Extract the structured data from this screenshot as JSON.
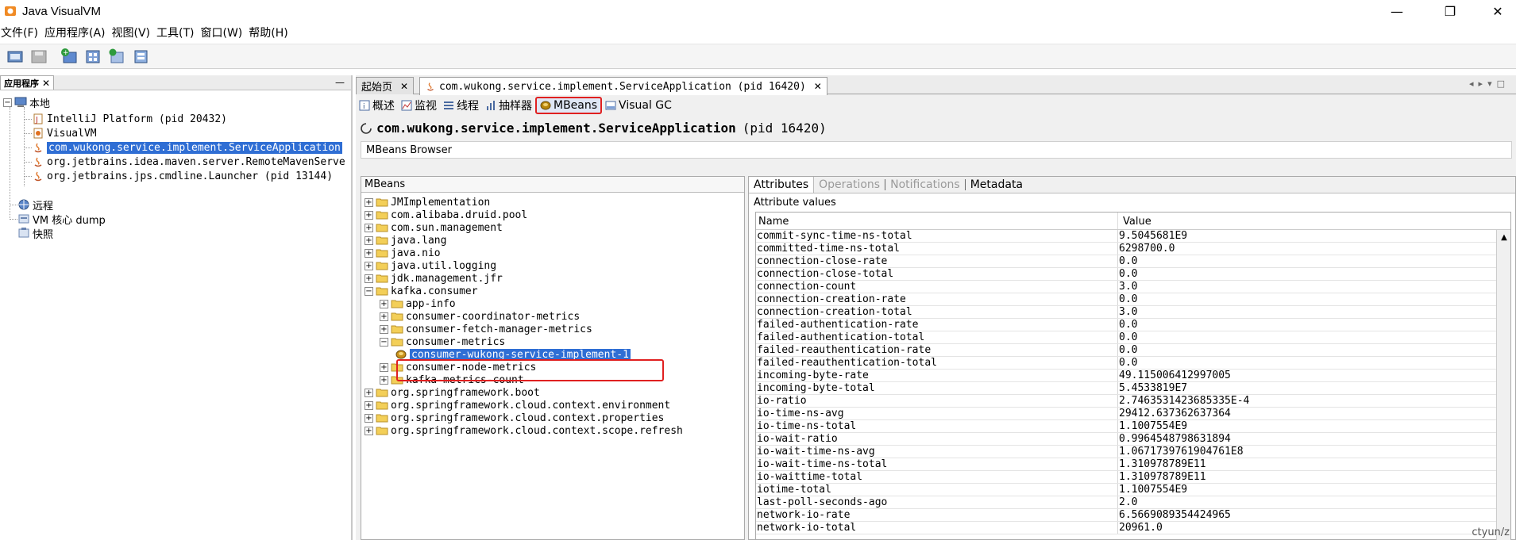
{
  "window": {
    "title": "Java VisualVM",
    "minimize": "—",
    "maximize": "❐",
    "close": "✕"
  },
  "menu": [
    "文件(F)",
    "应用程序(A)",
    "视图(V)",
    "工具(T)",
    "窗口(W)",
    "帮助(H)"
  ],
  "left_panel": {
    "tab_label": "应用程序",
    "tab_close": "✕",
    "minimize": "—",
    "local": "本地",
    "apps": [
      "IntelliJ Platform (pid 20432)",
      "VisualVM",
      "com.wukong.service.implement.ServiceApplication",
      "org.jetbrains.idea.maven.server.RemoteMavenServe",
      "org.jetbrains.jps.cmdline.Launcher (pid 13144)"
    ],
    "remote": "远程",
    "vm_dump": "VM 核心 dump",
    "snapshot": "快照"
  },
  "doc_tabs": {
    "start_page": "起始页",
    "app_tab": "com.wukong.service.implement.ServiceApplication (pid 16420)",
    "close": "✕"
  },
  "sub_tabs": [
    "概述",
    "监视",
    "线程",
    "抽样器",
    "MBeans",
    "Visual GC"
  ],
  "app_header": {
    "name": "com.wukong.service.implement.ServiceApplication",
    "pid": "(pid 16420)"
  },
  "mbeans_browser_label": "MBeans Browser",
  "mbeans_pane_title": "MBeans",
  "mbeans_tree": {
    "top_before": [
      "JMImplementation",
      "com.alibaba.druid.pool",
      "com.sun.management",
      "java.lang",
      "java.nio",
      "java.util.logging",
      "jdk.management.jfr"
    ],
    "kafka": "kafka.consumer",
    "kafka_children_before": [
      "app-info",
      "consumer-coordinator-metrics",
      "consumer-fetch-manager-metrics"
    ],
    "consumer_metrics": "consumer-metrics",
    "selected_leaf": "consumer-wukong-service-implement-1",
    "kafka_children_after": [
      "consumer-node-metrics",
      "kafka-metrics-count"
    ],
    "top_after": [
      "org.springframework.boot",
      "org.springframework.cloud.context.environment",
      "org.springframework.cloud.context.properties",
      "org.springframework.cloud.context.scope.refresh"
    ]
  },
  "detail_tabs": [
    "Attributes",
    "Operations",
    "Notifications",
    "Metadata"
  ],
  "attr_values_label": "Attribute values",
  "attr_table": {
    "col_name": "Name",
    "col_value": "Value",
    "rows": [
      [
        "commit-sync-time-ns-total",
        "9.5045681E9"
      ],
      [
        "committed-time-ns-total",
        "6298700.0"
      ],
      [
        "connection-close-rate",
        "0.0"
      ],
      [
        "connection-close-total",
        "0.0"
      ],
      [
        "connection-count",
        "3.0"
      ],
      [
        "connection-creation-rate",
        "0.0"
      ],
      [
        "connection-creation-total",
        "3.0"
      ],
      [
        "failed-authentication-rate",
        "0.0"
      ],
      [
        "failed-authentication-total",
        "0.0"
      ],
      [
        "failed-reauthentication-rate",
        "0.0"
      ],
      [
        "failed-reauthentication-total",
        "0.0"
      ],
      [
        "incoming-byte-rate",
        "49.115006412997005"
      ],
      [
        "incoming-byte-total",
        "5.4533819E7"
      ],
      [
        "io-ratio",
        "2.7463531423685335E-4"
      ],
      [
        "io-time-ns-avg",
        "29412.637362637364"
      ],
      [
        "io-time-ns-total",
        "1.1007554E9"
      ],
      [
        "io-wait-ratio",
        "0.9964548798631894"
      ],
      [
        "io-wait-time-ns-avg",
        "1.0671739761904761E8"
      ],
      [
        "io-wait-time-ns-total",
        "1.310978789E11"
      ],
      [
        "io-waittime-total",
        "1.310978789E11"
      ],
      [
        "iotime-total",
        "1.1007554E9"
      ],
      [
        "last-poll-seconds-ago",
        "2.0"
      ],
      [
        "network-io-rate",
        "6.5669089354424965"
      ],
      [
        "network-io-total",
        "20961.0"
      ]
    ]
  },
  "scroll_up": "▲",
  "watermark": "ctyun/z",
  "colors": {
    "selection": "#2f6ed4",
    "highlight_box": "#e02020"
  }
}
